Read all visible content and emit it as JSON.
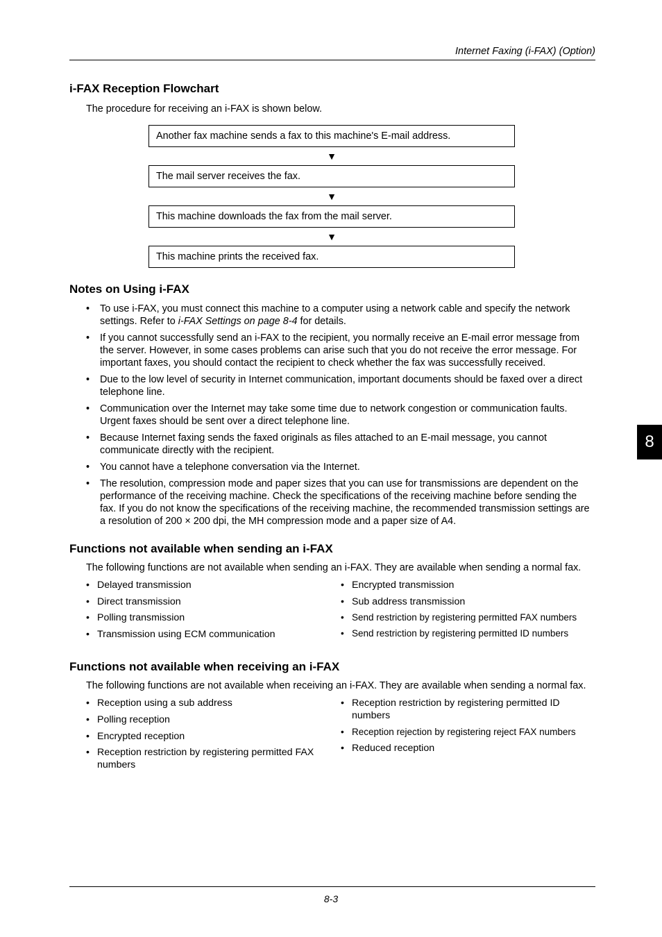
{
  "header": {
    "running": "Internet Faxing (i-FAX) (Option)"
  },
  "tab": {
    "number": "8"
  },
  "footer": {
    "page": "8-3"
  },
  "sec1": {
    "title": "i-FAX Reception Flowchart",
    "intro": "The procedure for receiving an i-FAX is shown below.",
    "flow": [
      "Another fax machine sends a fax to this machine's E-mail address.",
      "The mail server receives the fax.",
      "This machine downloads the fax from the mail server.",
      "This machine prints the received fax."
    ]
  },
  "sec2": {
    "title": "Notes on Using i-FAX",
    "items": [
      {
        "pre": "To use i-FAX, you must connect this machine to a computer using a network cable and specify the network settings. Refer to ",
        "ref": "i-FAX Settings on page 8-4",
        "post": " for details."
      },
      {
        "pre": "If you cannot successfully send an i-FAX to the recipient, you normally receive an E-mail error message from the server. However, in some cases problems can arise such that you do not receive the error message. For important faxes, you should contact the recipient to check whether the fax was successfully received."
      },
      {
        "pre": "Due to the low level of security in Internet communication, important documents should be faxed over a direct telephone line."
      },
      {
        "pre": "Communication over the Internet may take some time due to network congestion or communication faults. Urgent faxes should be sent over a direct telephone line."
      },
      {
        "pre": "Because Internet faxing sends the faxed originals as files attached to an E-mail message, you cannot communicate directly with the recipient."
      },
      {
        "pre": "You cannot have a telephone conversation via the Internet."
      },
      {
        "pre": "The resolution, compression mode and paper sizes that you can use for transmissions are dependent on the performance of the receiving machine. Check the specifications of the receiving machine before sending the fax. If you do not know the specifications of the receiving machine, the recommended transmission settings are a resolution of 200 × 200 dpi, the MH compression mode and a paper size of A4."
      }
    ]
  },
  "sec3": {
    "title": "Functions not available when sending an i-FAX",
    "intro": "The following functions are not available when sending an i-FAX. They are available when sending a normal fax.",
    "left": [
      "Delayed transmission",
      "Direct transmission",
      "Polling transmission",
      "Transmission using ECM communication"
    ],
    "right": [
      "Encrypted transmission",
      "Sub address transmission",
      "Send restriction by registering permitted FAX numbers",
      "Send restriction by registering permitted ID numbers"
    ]
  },
  "sec4": {
    "title": "Functions not available when receiving an i-FAX",
    "intro": "The following functions are not available when receiving an i-FAX. They are available when sending a normal fax.",
    "left": [
      "Reception using a sub address",
      "Polling reception",
      "Encrypted reception",
      "Reception restriction by registering permitted FAX numbers"
    ],
    "right": [
      "Reception restriction by registering permitted ID numbers",
      "Reception rejection by registering reject FAX numbers",
      "Reduced reception"
    ]
  }
}
